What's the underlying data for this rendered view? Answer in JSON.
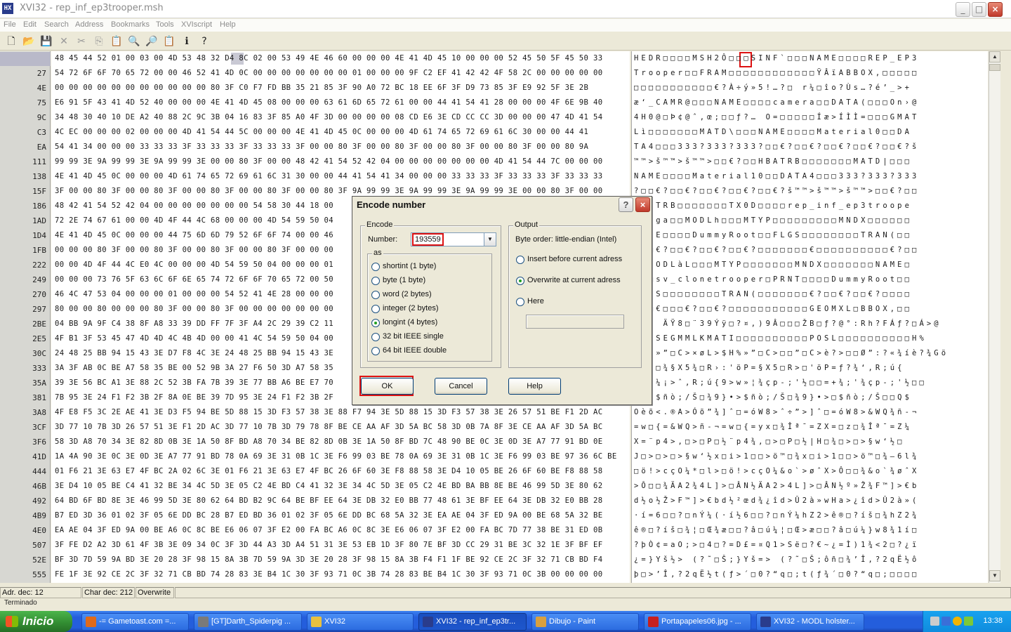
{
  "window": {
    "title": "XVI32 - rep_inf_ep3trooper.msh",
    "app_icon_text": "HX",
    "minimize": "_",
    "maximize": "□",
    "close": "×"
  },
  "menu": [
    "File",
    "Edit",
    "Search",
    "Address",
    "Bookmarks",
    "Tools",
    "XVIscript",
    "Help"
  ],
  "toolbar": {
    "icons": [
      "new-file-icon",
      "open-folder-icon",
      "save-icon",
      "close-x-icon",
      "cut-icon",
      "copy-icon",
      "paste-icon",
      "find-icon",
      "find-replace-icon",
      "clipboard-icon",
      "script-icon",
      "help-icon"
    ],
    "glyphs": [
      "🗋",
      "📂",
      "💾",
      "✕",
      "✂",
      "⎘",
      "📋",
      "🔍",
      "🔎",
      "📋",
      "ℹ",
      "?"
    ]
  },
  "hex": {
    "offsets": [
      "0",
      "27",
      "4E",
      "75",
      "9C",
      "C3",
      "EA",
      "111",
      "138",
      "15F",
      "186",
      "1AD",
      "1D4",
      "1FB",
      "222",
      "249",
      "270",
      "297",
      "2BE",
      "2E5",
      "30C",
      "333",
      "35A",
      "381",
      "3A8",
      "3CF",
      "3F6",
      "41D",
      "444",
      "46B",
      "492",
      "4B9",
      "4E0",
      "507",
      "52E",
      "555"
    ],
    "left_rows": [
      "48 45 44 52 01 00 03 00 4D 53 48 32 D4 8C 02 00 53 49 4E 46 60 00 00 00 4E 41 4D 45 10 00 00 00 52 45 50 5F 45 50 33",
      "54 72 6F 6F 70 65 72 00 00 46 52 41 4D 0C 00 00 00 00 00 00 00 01 00 00 00 9F C2 EF 41 42 42 4F 58 2C 00 00 00 00 00",
      "00 00 00 00 00 00 00 00 00 00 00 80 3F C0 F7 FD BB 35 21 85 3F 90 A0 72 BC 18 EE 6F 3F D9 73 85 3F E9 92 5F 3E 2B",
      "E6 91 5F 43 41 4D 52 40 00 00 00 4E 41 4D 45 08 00 00 00 63 61 6D 65 72 61 00 00 44 41 54 41 28 00 00 00 4F 6E 9B 40",
      "34 48 30 40 10 DE A2 40 88 2C 9C 3B 04 16 83 3F 85 A0 4F 3D 00 00 00 00 08 CD E6 3E CD CC CC 3D 00 00 00 47 4D 41 54",
      "4C EC 00 00 00 02 00 00 00 4D 41 54 44 5C 00 00 00 4E 41 4D 45 0C 00 00 00 4D 61 74 65 72 69 61 6C 30 00 00 44 41",
      "54 41 34 00 00 00 33 33 33 3F 33 33 33 3F 33 33 33 3F 00 00 80 3F 00 00 80 3F 00 00 80 3F 00 00 80 3F 00 00 80 9A",
      "99 99 3E 9A 99 99 3E 9A 99 99 3E 00 00 80 3F 00 00 48 42 41 54 52 42 04 00 00 00 00 00 00 00 4D 41 54 44 7C 00 00 00",
      "4E 41 4D 45 0C 00 00 00 4D 61 74 65 72 69 61 6C 31 30 00 00 44 41 54 41 34 00 00 00 33 33 33 3F 33 33 33 3F 33 33 33",
      "3F 00 00 80 3F 00 00 80 3F 00 00 80 3F 00 00 80 3F 00 00 80 3F 9A 99 99 3E 9A 99 99 3E 9A 99 99 3E 00 00 80 3F 00 00",
      "48 42 41 54 52 42 04 00 00 00 00 00 00 00 54 58 30 44 18 00",
      "72 2E 74 67 61 00 00 4D 4F 44 4C 68 00 00 00 4D 54 59 50 04",
      "4E 41 4D 45 0C 00 00 00 44 75 6D 6D 79 52 6F 6F 74 00 00 46",
      "00 00 00 80 3F 00 00 80 3F 00 00 80 3F 00 00 80 3F 00 00 00",
      "00 00 4D 4F 44 4C E0 4C 00 00 00 4D 54 59 50 04 00 00 00 01",
      "00 00 00 73 76 5F 63 6C 6F 6E 65 74 72 6F 6F 70 65 72 00 50",
      "46 4C 47 53 04 00 00 00 01 00 00 00 54 52 41 4E 28 00 00 00",
      "80 00 00 80 00 00 00 80 3F 00 00 80 3F 00 00 00 00 00 00 00",
      "04 BB 9A 9F C4 38 8F A8 33 39 DD FF 7F 3F A4 2C 29 39 C2 11",
      "4F B1 3F 53 45 47 4D 4D 4C 4B 4D 00 00 41 4C 54 59 50 04 00",
      "24 48 25 BB 94 15 43 3E D7 F8 4C 3E 24 48 25 BB 94 15 43 3E",
      "3A 3F AB 0C BE A7 58 35 BE 00 52 9B 3A 27 F6 50 3D A7 58 35",
      "39 3E 56 BC A1 3E 88 2C 52 3B FA 7B 39 3E 77 BB A6 BE E7 70",
      "7B 95 3E 24 F1 F2 3B 2F 8A 0E BE 39 7D 95 3E 24 F1 F2 3B 2F",
      "4F E8 F5 3C 2E AE 41 3E D3 F5 94 BE 5D 88 15 3D F3 57 38 3E 88 F7 94 3E 5D 88 15 3D F3 57 38 3E 26 57 51 BE F1 2D AC",
      "3D 77 10 7B 3D 26 57 51 3E F1 2D AC 3D 77 10 7B 3D 79 78 8F BE CE AA AF 3D 5A BC 58 3D 0B 7A 8F 3E CE AA AF 3D 5A BC",
      "58 3D A8 70 34 3E 82 8D 0B 3E 1A 50 8F BD A8 70 34 BE 82 8D 0B 3E 1A 50 8F BD 7C 48 90 BE 0C 3E 0D 3E A7 77 91 BD 0E",
      "1A 4A 90 3E 0C 3E 0D 3E A7 77 91 BD 78 0A 69 3E 31 0B 1C 3E F6 99 03 BE 78 0A 69 3E 31 0B 1C 3E F6 99 03 BE 97 36 6C BE",
      "01 F6 21 3E 63 E7 4F BC 2A 02 6C 3E 01 F6 21 3E 63 E7 4F BC 26 6F 60 3E F8 88 58 3E D4 10 05 BE 26 6F 60 BE F8 88 58",
      "3E D4 10 05 BE C4 41 32 BE 34 4C 5D 3E 05 C2 4E BD C4 41 32 3E 34 4C 5D 3E 05 C2 4E BD BA BB 8E BE 46 99 5D 3E 80 62",
      "64 BD 6F BD 8E 3E 46 99 5D 3E 80 62 64 BD B2 9C 64 BE BF EE 64 3E DB 32 E0 BB 77 48 61 3E BF EE 64 3E DB 32 E0 BB 28",
      "B7 ED 3D 36 01 02 3F 05 6E DD BC 28 B7 ED BD 36 01 02 3F 05 6E DD BC 68 5A 32 3E EA AE 04 3F ED 9A 00 BE 68 5A 32 BE",
      "EA AE 04 3F ED 9A 00 BE A6 0C 8C BE E6 06 07 3F E2 00 FA BC A6 0C 8C 3E E6 06 07 3F E2 00 FA BC 7D 77 38 BE 31 ED 0B",
      "3F FE D2 A2 3D 61 4F 3B 3E 09 34 0C 3F 3D 44 A3 3D A4 51 31 3E 53 EB 1D 3F 80 7E BF 3D CC 29 31 BE 3C 32 1E 3F BF EF",
      "BF 3D 7D 59 9A BD 3E 20 28 3F 98 15 8A 3B 7D 59 9A 3D 3E 20 28 3F 98 15 8A 3B F4 F1 1F BE 92 CE 2C 3F 32 71 CB BD F4",
      "FE 1F 3E 92 CE 2C 3F 32 71 CB BD 74 28 83 3E B4 1C 30 3F 93 71 0C 3B 74 28 83 BE B4 1C 30 3F 93 71 0C 3B 00 00 00 00"
    ],
    "right_rows": [
      "HEDR□□□□MSH2Ô□□□SINF`□□□NAME□□□□REP_EP3",
      "Trooper□□FRAM□□□□□□□□□□□□ŸÂïABBOX,□□□□□",
      "□□□□□□□□□□□€?À÷ý»5!…?□ r¼□îo?Ùs…?é’_>+",
      "æ‘_CAMR@□□□NAME□□□□camera□□DATA(□□□On›@",
      "4H0@□Þ¢@ˆ,œ;□□ƒ?… O=□□□□□Íæ>ÍÌÌ=□□□GMAT",
      "Lì□□□□□□□MATD\\□□□NAME□□□□Material0□□DA",
      "TA4□□□333?333?333?□□€?□□€?□□€?□□€?□□€?š",
      "™™>š™™>š™™>□□€?□□HBATRB□□□□□□□MATD|□□□",
      "NAME□□□□Material10□□DATA4□□□333?333?333",
      "?□□€?□□€?□□€?□□€?□□€?š™™>š™™>š™™>□□€?□□",
      "HBATRB□□□□□□□TX0D□□□□rep_inf_ep3troope",
      "r.tga□□MODLh□□□MTYP□□□□□□□□□MNDX□□□□□□",
      "NAME□□□□DummyRoot□□FLGS□□□□□□□□TRAN(□□",
      "□□□€?□□€?□□€?□□€?□□□□□□□€□□□□□□□□□□€?□□",
      "□□MODLàL□□□MTYP□□□□□□□MNDX□□□□□□□NAME□",
      "□□□sv_clonetrooper□PRNT□□□□DummyRoot□□",
      "FLGS□□□□□□□□TRAN(□□□□□□□€?□□€?□□€?□□□□",
      "€□□€□□□€?□□€?□□□□□□□□□□□GEOMXL□BBOX,□□",
      "□»š ÄŸ8□¨39Ýÿ□?¤,)9Â□□□ŽB□ƒ?@°:Rh?FÁƒ?□Á>@",
      "O±?SEGMMLKMATI□□□□□□□□□□POSL□□□□□□□□□□H%",
      "$H%»”□C>×øL>$H%»”□C>□□”□C>è?>□□Ø”:?«¾íè?¾Gö",
      ":?«□¾§X5¾□R›:'öP=§X5□R>□'öP=ƒ?¾‘,R;ú{",
      "9>V¼¡>ˆ,R;ú{9>w»¦¾çp-;'½□□=+¾;'¾çp-;'½□□",
      "{•>$ñò;/Š□¾9}•>$ñò;/Š□¾9}•>□$ñò;/Š□□Q$",
      "Oèõ<.®A>Óõ”¾]ˆ□=óW8>ˆ÷”>]ˆ□=óW8>&WQ¾ñ-¬",
      "=w□{=&WQ>ñ-¬=w□{=yx□¾Îª¯=ZX=□z□¾Îª¯=Z¼",
      "X=¨p4>‚□>□P□½¨p4¾‚□>□P□½|H□¾□>□>§w‘½□",
      "J□>□>□>§w‘½x□i>1□□>ö™□¾x□i>1□□>ö™□¾—6l¾",
      "□ö!>cçO¼*□l>□ö!>cçO¼&o`>øˆX>Ô□□¾&o`¾øˆX",
      ">Ô□□¾ÄA2¾4L]>□ÂN½ÄA2>4L]>□ÂN½º»Ž¾F™]>€b",
      "d½o½Ž>F™]>€bd½²œd¾¿îd>Û2à»wHa>¿îd>Û2à»(",
      "·í=6□□?□nÝ¼(·í½6□□?□nÝ¼hZ2>ê®□?íš□¾hZ2¾",
      "ê®□?íš□¾¦□Œ¾æ□□?â□ú¼¦□Œ>æ□□?â□ú¼}w8¾1í□",
      "?þÒ¢=aO;>□4□?=D£=¤Q1>Së□?€~¿=Ì)1¾<2□?¿ï",
      "¿=}Yš½> (?˜□Š;}Yš=> (?˜□Š;ôñ□¾’Î,?2qË½ô",
      "þ□>’Î,?2qË½t(ƒ>´□0?“q□;t(ƒ¾´□0?“q□;□□□□"
    ]
  },
  "status": {
    "adr": "Adr. dec: 12",
    "char": "Char dec: 212",
    "mode": "Overwrite",
    "bottom": "Terminado"
  },
  "dialog": {
    "title": "Encode number",
    "help_btn": "?",
    "close_btn": "×",
    "encode_group": "Encode",
    "number_label": "Number:",
    "number_value": "193559",
    "as_group": "as",
    "as_options": [
      {
        "label": "shortint (1 byte)",
        "selected": false
      },
      {
        "label": "byte (1 byte)",
        "selected": false
      },
      {
        "label": "word (2 bytes)",
        "selected": false
      },
      {
        "label": "integer (2 bytes)",
        "selected": false
      },
      {
        "label": "longint (4 bytes)",
        "selected": true
      },
      {
        "label": "32 bit IEEE single",
        "selected": false
      },
      {
        "label": "64 bit IEEE double",
        "selected": false
      }
    ],
    "output_group": "Output",
    "byte_order": "Byte order: little-endian (Intel)",
    "output_options": [
      {
        "label": "Insert before current adress",
        "selected": false
      },
      {
        "label": "Overwrite at current adress",
        "selected": true
      },
      {
        "label": "Here",
        "selected": false
      }
    ],
    "ok": "OK",
    "cancel": "Cancel",
    "help": "Help"
  },
  "taskbar": {
    "start": "Inicio",
    "tasks": [
      {
        "label": "-= Gametoast.com =...",
        "icon": "firefox-icon",
        "color": "#e06a1a",
        "active": false
      },
      {
        "label": "[GT]Darth_Spiderpig ...",
        "icon": "window-icon",
        "color": "#7a7a7a",
        "active": false
      },
      {
        "label": "XVI32",
        "icon": "folder-icon",
        "color": "#e8c040",
        "active": false
      },
      {
        "label": "XVI32 - rep_inf_ep3tr...",
        "icon": "xvi32-icon",
        "color": "#2a3c8c",
        "active": true
      },
      {
        "label": "Dibujo - Paint",
        "icon": "paint-icon",
        "color": "#d8a040",
        "active": false
      },
      {
        "label": "Portapapeles06.jpg - ...",
        "icon": "image-icon",
        "color": "#c62020",
        "active": false
      },
      {
        "label": "XVI32 - MODL holster...",
        "icon": "xvi32-icon",
        "color": "#2a3c8c",
        "active": false
      }
    ],
    "clock": "13:38"
  }
}
